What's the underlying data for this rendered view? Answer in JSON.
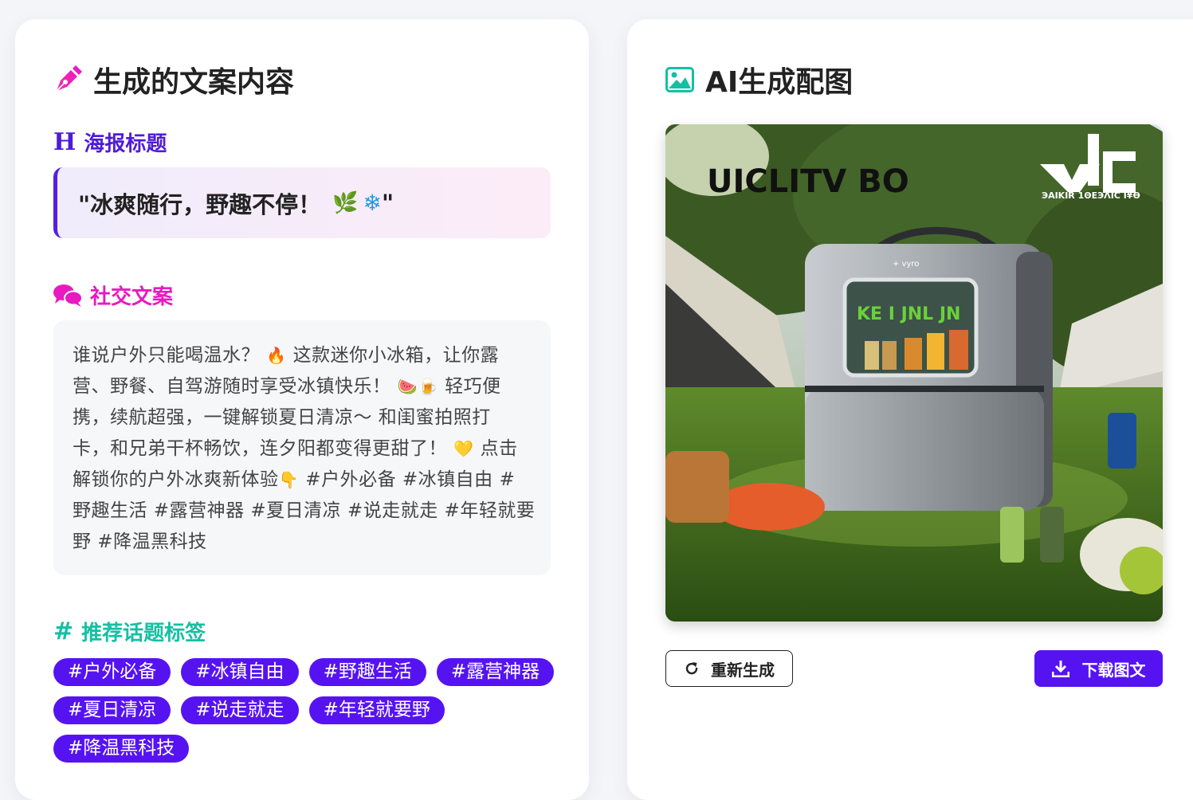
{
  "left_card": {
    "title": "生成的文案内容",
    "title_icon": "pen-nib-icon",
    "headline_section": {
      "icon": "heading-icon",
      "title": "海报标题",
      "text": "\"冰爽随行，野趣不停！",
      "emoji_1": "🌿",
      "emoji_2": "❄",
      "close_quote": "\""
    },
    "social_section": {
      "icon": "comments-icon",
      "title": "社交文案",
      "lines": [
        [
          "谁说户外只能喝温水？ ",
          "🔥",
          " 这款迷你小冰箱，让你露"
        ],
        [
          "营、野餐、自驾游随时享受冰镇快乐！ ",
          "🍉",
          "🍺",
          " 轻巧便"
        ],
        [
          "携，续航超强，一键解锁夏日清凉～ 和闺蜜拍照打"
        ],
        [
          "卡，和兄弟干杯畅饮，连夕阳都变得更甜了！ ",
          "💛",
          " 点击"
        ],
        [
          "解锁你的户外冰爽新体验",
          "👇",
          " #户外必备 #冰镇自由 #"
        ],
        [
          "野趣生活 #露营神器 #夏日清凉 #说走就走 #年轻就要"
        ],
        [
          "野 #降温黑科技"
        ]
      ]
    },
    "tags_section": {
      "icon": "hashtag-icon",
      "title": "推荐话题标签",
      "rows": [
        [
          "#户外必备",
          "#冰镇自由",
          "#野趣生活",
          "#露营神器"
        ],
        [
          "#夏日清凉",
          "#说走就走",
          "#年轻就要野"
        ],
        [
          "#降温黑科技"
        ]
      ]
    }
  },
  "right_card": {
    "title": "AI生成配图",
    "title_icon": "image-icon",
    "image": {
      "alt": "mini fridge camping poster",
      "logo_text_left": "UICLITV BO",
      "logo_text_right": "ЭAIKIR 1ΘЕЭΛIC I¥Ѳ",
      "fridge_brand": "+ vyro",
      "window_text": "KE I JNL JN"
    },
    "regenerate_button": {
      "label": "重新生成",
      "icon": "redo-icon"
    },
    "download_button": {
      "label": "下载图文",
      "icon": "download-icon"
    }
  },
  "colors": {
    "accent_purple": "#5613f2",
    "headline_purple": "#4f1bd8",
    "social_pink": "#e81ac0",
    "tags_teal": "#14c0a4"
  }
}
